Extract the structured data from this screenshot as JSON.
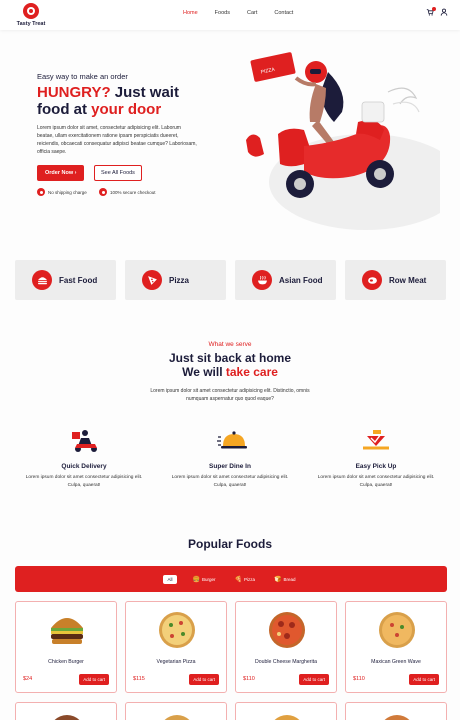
{
  "header": {
    "logo_text": "Tasty Treat",
    "nav": [
      "Home",
      "Foods",
      "Cart",
      "Contact"
    ],
    "active_nav": "Home",
    "icons": [
      "cart-icon",
      "user-icon"
    ]
  },
  "hero": {
    "subtitle": "Easy way to make an order",
    "title_red1": "HUNGRY?",
    "title_dark1": " Just wait",
    "title_dark2": "food at ",
    "title_red2": "your door",
    "description": "Lorem ipsum dolor sit amet, consectetur adipisicing elit. Laborum beatae, ullam exercitationem ratione ipsam perspiciatis dueeret, reiciendis, obcaecati consequatur adipisci beatae cumque? Laboriosam, officia saepe.",
    "order_button": "Order Now ›",
    "all_foods_button": "See All Foods",
    "features": [
      "No shipping charge",
      "100% secure checkout"
    ]
  },
  "categories": [
    {
      "label": "Fast Food",
      "icon": "burger-icon"
    },
    {
      "label": "Pizza",
      "icon": "pizza-icon"
    },
    {
      "label": "Asian Food",
      "icon": "bowl-icon"
    },
    {
      "label": "Row Meat",
      "icon": "meat-icon"
    }
  ],
  "serve": {
    "tag": "What we serve",
    "title_line1": "Just sit back at home",
    "title_line2_dark": "We will ",
    "title_line2_red": "take care",
    "description": "Lorem ipsum dolor sit amet consectetur adipisicing elit. Distinctio, omnis numquam aspernatur quo quod eaque?",
    "services": [
      {
        "title": "Quick Delivery",
        "desc": "Lorem ipsum dolor sit amet consectetur adipisicing elit. Culpa, quaerat!"
      },
      {
        "title": "Super Dine In",
        "desc": "Lorem ipsum dolor sit amet consectetur adipisicing elit. Culpa, quaerat!"
      },
      {
        "title": "Easy Pick Up",
        "desc": "Lorem ipsum dolor sit amet consectetur adipisicing elit. Culpa, quaerat!"
      }
    ]
  },
  "popular": {
    "title": "Popular Foods",
    "filters": [
      {
        "label": "All",
        "icon": ""
      },
      {
        "label": "Burger",
        "icon": "burger-icon"
      },
      {
        "label": "Pizza",
        "icon": "pizza-icon"
      },
      {
        "label": "Bread",
        "icon": "bread-icon"
      }
    ],
    "active_filter": "All",
    "add_label": "Add to cart",
    "products": [
      {
        "name": "Chicken Burger",
        "price": "$24"
      },
      {
        "name": "Vegetarian Pizza",
        "price": "$115"
      },
      {
        "name": "Double Cheese Margherita",
        "price": "$110"
      },
      {
        "name": "Maxican Green Wave",
        "price": "$110"
      }
    ]
  },
  "colors": {
    "accent": "#df2020",
    "dark": "#1c1c3a",
    "card_bg": "#ededed"
  }
}
